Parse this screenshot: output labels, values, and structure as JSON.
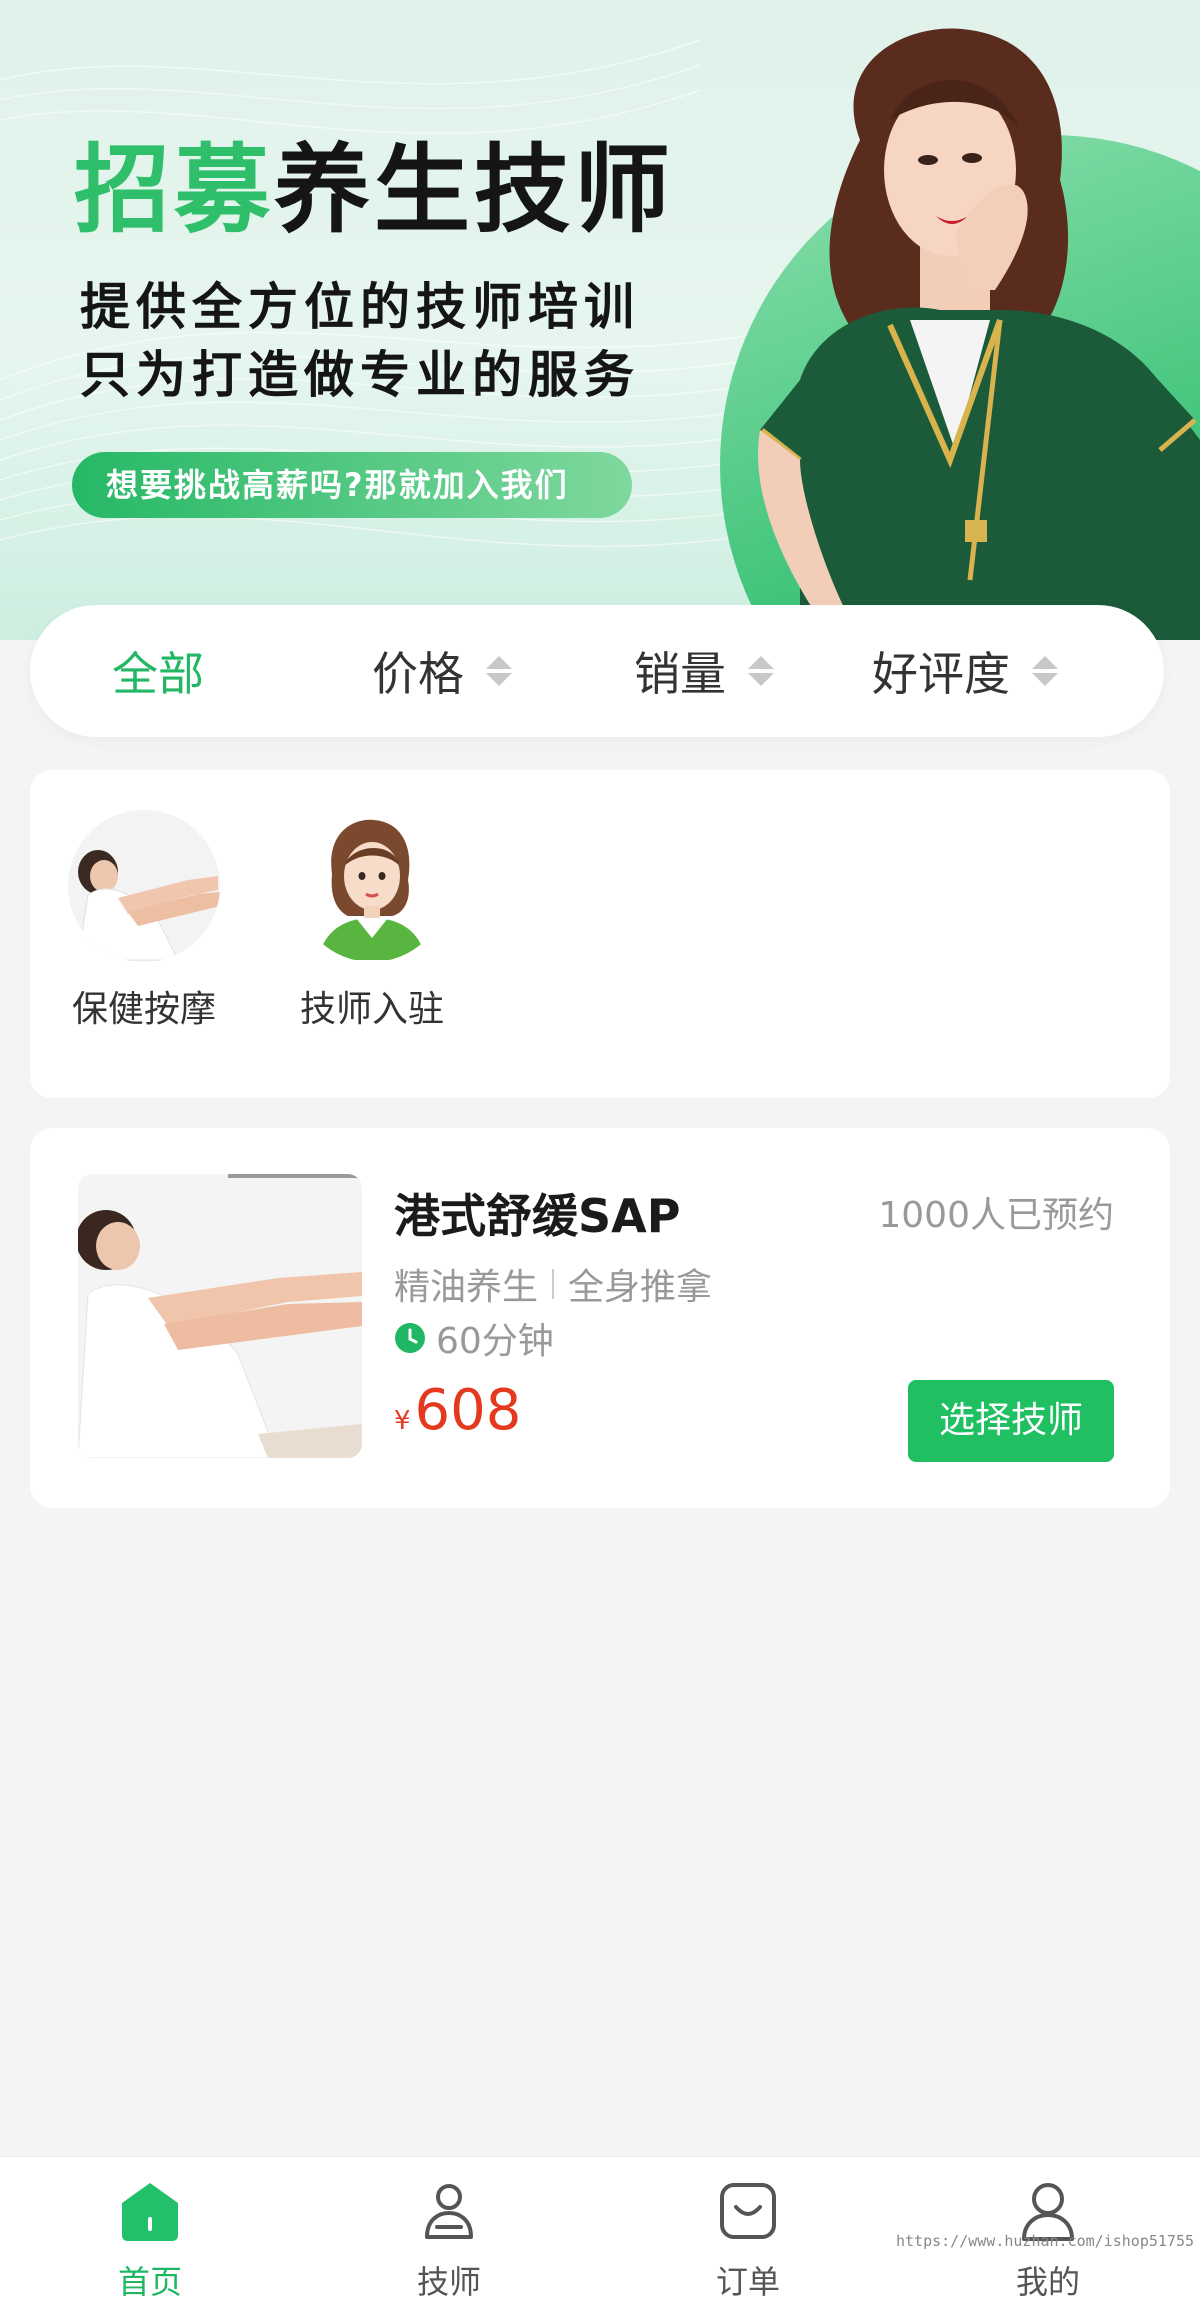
{
  "banner": {
    "title_green": "招募",
    "title_black": "养生技师",
    "subtitle_1": "提供全方位的技师培训",
    "subtitle_2": "只为打造做专业的服务",
    "cta": "想要挑战高薪吗?那就加入我们"
  },
  "filters": [
    {
      "label": "全部",
      "active": true
    },
    {
      "label": "价格",
      "active": false
    },
    {
      "label": "销量",
      "active": false
    },
    {
      "label": "好评度",
      "active": false
    }
  ],
  "categories": [
    {
      "label": "保健按摩",
      "icon": "massage-photo-icon"
    },
    {
      "label": "技师入驻",
      "icon": "technician-avatar-icon"
    }
  ],
  "service": {
    "name": "港式舒缓SAP",
    "booked": "1000人已预约",
    "tag_1": "精油养生",
    "tag_2": "全身推拿",
    "duration": "60分钟",
    "currency": "¥",
    "price": "608",
    "button": "选择技师"
  },
  "tabs": [
    {
      "label": "首页",
      "icon": "home-icon",
      "active": true
    },
    {
      "label": "技师",
      "icon": "technician-icon",
      "active": false
    },
    {
      "label": "订单",
      "icon": "order-icon",
      "active": false
    },
    {
      "label": "我的",
      "icon": "profile-icon",
      "active": false
    }
  ],
  "watermark": "https://www.huzhan.com/ishop51755",
  "colors": {
    "accent": "#20b764",
    "price": "#e5391f",
    "background": "#f4f4f4"
  }
}
